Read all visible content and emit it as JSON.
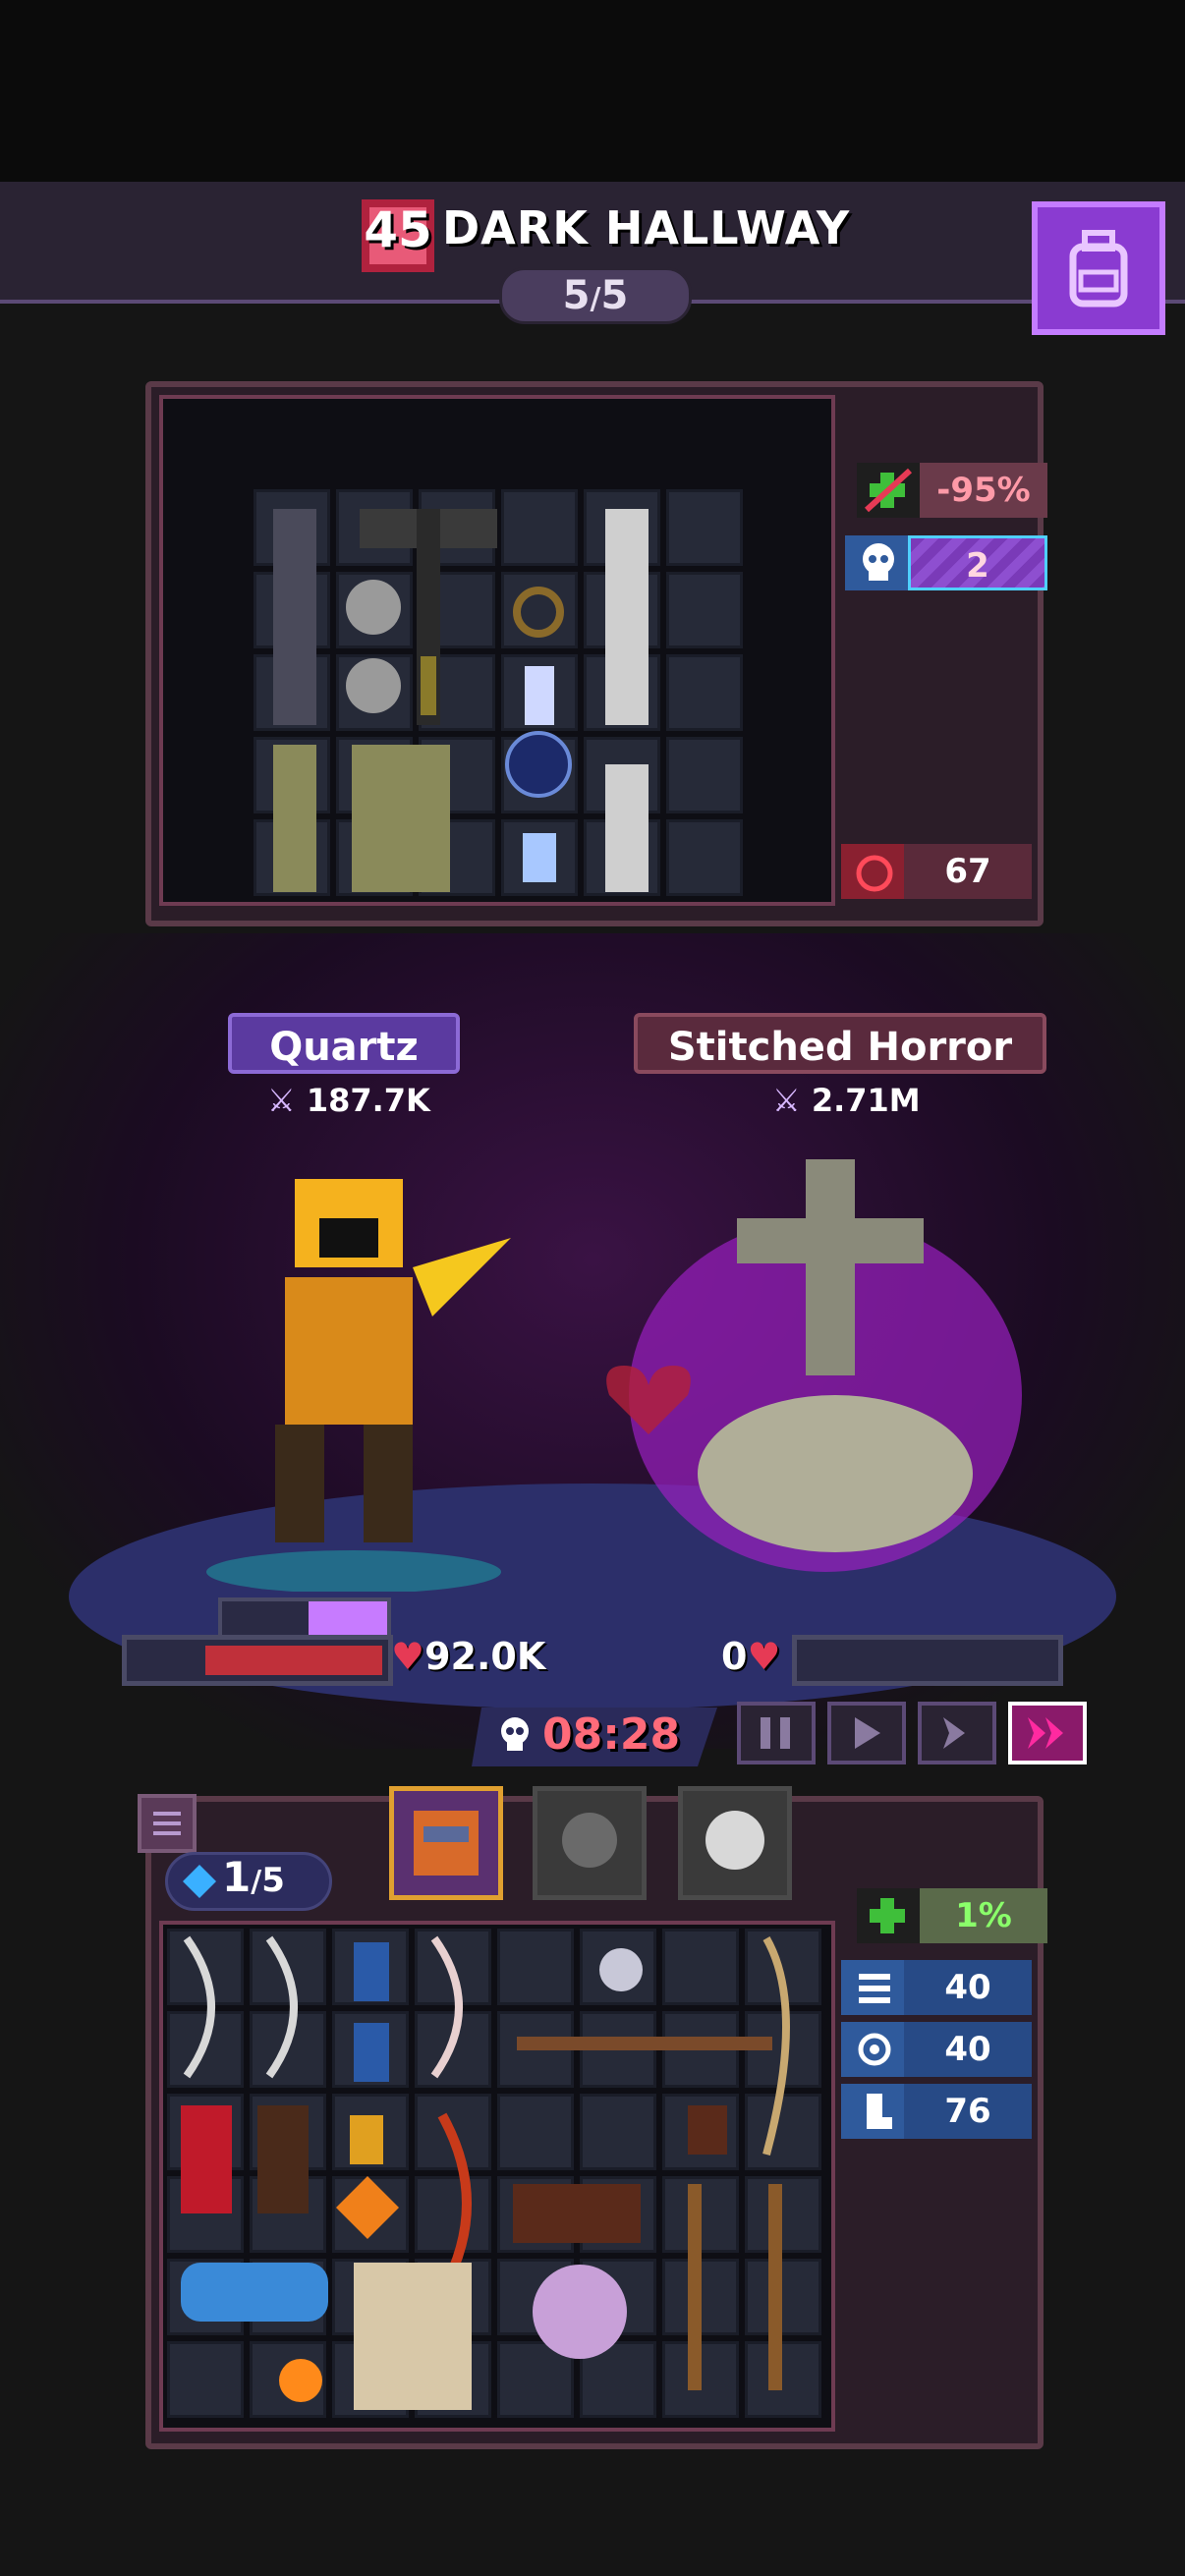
{
  "header": {
    "level": "45",
    "area_name": "DARK HALLWAY",
    "wave_current": "5",
    "wave_total": "5"
  },
  "enemy_stats": {
    "damage_reduction": "-95%",
    "kills": "2",
    "rage": "67"
  },
  "hero": {
    "name": "Quartz",
    "power": "187.7K",
    "hp": "92.0K",
    "hp_fraction": 1.0
  },
  "enemy": {
    "name": "Stitched Horror",
    "power": "2.71M",
    "hp": "0",
    "hp_fraction": 0.0
  },
  "timer": "08:28",
  "controls": [
    "pause",
    "play",
    "fast",
    "fastest"
  ],
  "inventory": {
    "gems_current": "1",
    "gems_total": "5",
    "stats": {
      "healing": "1%",
      "stat_a": "40",
      "stat_b": "40",
      "stat_c": "76"
    }
  },
  "colors": {
    "accent_purple": "#8a3bd1",
    "hp_red": "#e63a55",
    "timer_red": "#ff6b7a",
    "stat_blue": "#2f5a9c",
    "heal_green": "#3fbf3a"
  }
}
